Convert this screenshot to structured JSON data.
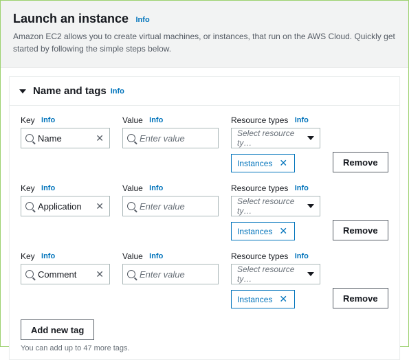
{
  "info_label": "Info",
  "header": {
    "title": "Launch an instance",
    "description": "Amazon EC2 allows you to create virtual machines, or instances, that run on the AWS Cloud. Quickly get started by following the simple steps below."
  },
  "panel": {
    "title": "Name and tags",
    "labels": {
      "key": "Key",
      "value": "Value",
      "resource_types": "Resource types",
      "value_placeholder": "Enter value",
      "select_placeholder": "Select resource ty…",
      "remove": "Remove"
    },
    "rows": [
      {
        "key": "Name",
        "value": "",
        "chip": "Instances"
      },
      {
        "key": "Application",
        "value": "",
        "chip": "Instances"
      },
      {
        "key": "Comment",
        "value": "",
        "chip": "Instances"
      }
    ],
    "add_button": "Add new tag",
    "hint": "You can add up to 47 more tags."
  }
}
